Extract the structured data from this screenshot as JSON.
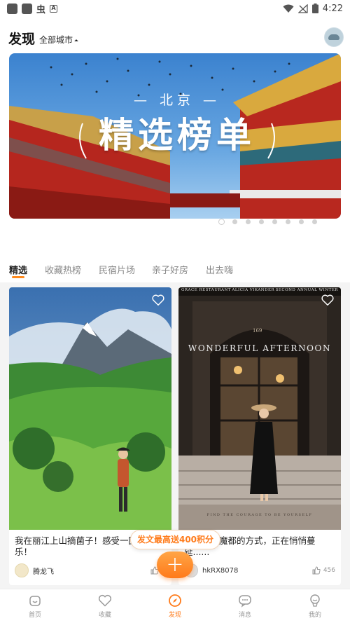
{
  "status_bar": {
    "time": "4:22",
    "icon_letter": "A",
    "app_glyph": "虫"
  },
  "header": {
    "title": "发现",
    "city_label": "全部城市"
  },
  "banner": {
    "city": "北京",
    "title": "精选榜单",
    "dot_count": 8,
    "active_dot": 0
  },
  "tabs": [
    {
      "label": "精选",
      "active": true
    },
    {
      "label": "收藏热榜",
      "active": false
    },
    {
      "label": "民宿片场",
      "active": false
    },
    {
      "label": "亲子好房",
      "active": false
    },
    {
      "label": "出去嗨",
      "active": false
    }
  ],
  "cards": [
    {
      "text": "我在丽江上山摘菌子！感受一回。快乐！",
      "author": "腾龙飞",
      "likes": "5"
    },
    {
      "text": "这种打开魔都的方式，正在悄悄蔓延......",
      "author": "hkRX8078",
      "likes": "456",
      "image_header_left": "GRACE RESTAURANT",
      "image_header_mid": "ALICIA VIKANDER",
      "image_header_right": "SECOND ANNUAL WINTER",
      "image_caption": "WONDERFUL AFTERNOON",
      "image_footer": "FIND THE COURAGE TO BE YOURSELF",
      "image_sign": "169"
    }
  ],
  "promo": {
    "label": "发文最高送400积分"
  },
  "fab": {
    "label": "+"
  },
  "bottom_nav": [
    {
      "label": "首页",
      "icon": "home-icon",
      "active": false
    },
    {
      "label": "收藏",
      "icon": "heart-icon",
      "active": false
    },
    {
      "label": "发现",
      "icon": "compass-icon",
      "active": true
    },
    {
      "label": "消息",
      "icon": "message-icon",
      "active": false
    },
    {
      "label": "我的",
      "icon": "profile-icon",
      "active": false
    }
  ],
  "colors": {
    "accent": "#ff7b1a",
    "tab_underline": "#ff8a1d"
  }
}
